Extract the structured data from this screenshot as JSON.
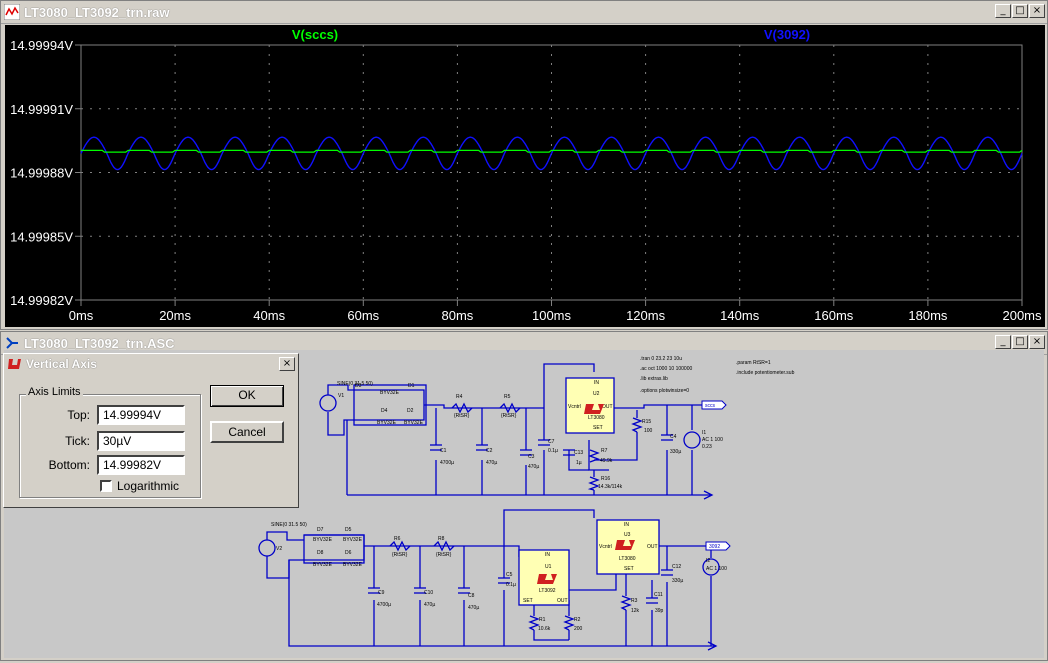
{
  "waveform_window": {
    "title": "LT3080_LT3092_trn.raw",
    "controls": {
      "minimize": "_",
      "maximize": "□",
      "close": "×"
    }
  },
  "chart_data": {
    "type": "line",
    "series": [
      {
        "name": "V(sccs)",
        "color": "#00ff00"
      },
      {
        "name": "V(3092)",
        "color": "#1010ff"
      }
    ],
    "x_ticks": [
      "0ms",
      "20ms",
      "40ms",
      "60ms",
      "80ms",
      "100ms",
      "120ms",
      "140ms",
      "160ms",
      "180ms",
      "200ms"
    ],
    "y_ticks": [
      "14.99994V",
      "14.99991V",
      "14.99988V",
      "14.99985V",
      "14.99982V"
    ],
    "xlim": [
      0,
      200
    ],
    "ylim": [
      14.99982,
      14.99994
    ],
    "sccs_level": 14.99989,
    "v3092_mean": 14.999889,
    "v3092_amplitude": 8e-06,
    "v3092_period_ms": 10
  },
  "schematic_window": {
    "title": "LT3080_LT3092_trn.ASC",
    "controls": {
      "minimize": "_",
      "maximize": "□",
      "close": "×"
    },
    "directives": [
      ".tran 0 23.2 23 10u",
      ".ac oct 1000 10 100000",
      ".lib extras.lib",
      ".options plotwinsize=0",
      ".param RtSR=1",
      ".include potentiometer.sub"
    ],
    "labels": {
      "v1": "V1",
      "v1src": "SINE(0 31.5 50)",
      "v2": "V2",
      "v2src": "SINE(0 31.5 50)",
      "d3": "D3",
      "d1": "D1",
      "d4": "D4",
      "d2": "D2",
      "d7": "D7",
      "d5": "D5",
      "d8": "D8",
      "d6": "D6",
      "diode": "BYV32E",
      "r4": "R4",
      "r5": "R5",
      "r6": "R6",
      "r8": "R8",
      "rval": "{RtSR}",
      "c1": "C1",
      "c2": "C2",
      "c3": "C3",
      "c7": "C7",
      "c13": "C13",
      "c4": "C4",
      "c9": "C9",
      "c10": "C10",
      "c8": "C8",
      "c5": "C5",
      "c11": "C11",
      "c12": "C12",
      "v4700": "4700µ",
      "v470": "470µ",
      "v01": "0.1µ",
      "v1u": "1µ",
      "v330": "330µ",
      "v39": "39p",
      "u2": "U2",
      "lt3080": "LT3080",
      "u3": "U3",
      "u1": "U1",
      "lt3092": "LT3092",
      "in": "IN",
      "out": "OUT",
      "set": "SET",
      "vcontrol": "Vcntrl",
      "r15": "R15",
      "r15v": "100",
      "r7": "R7",
      "r7v": "49.9k",
      "r16": "R16",
      "r16v": "14.3k/114k",
      "r3": "R3",
      "r3v": "12k",
      "r1": "R1",
      "r1v": "10.6k",
      "r2": "R2",
      "r2v": "200",
      "i1": "I1",
      "i1v": "AC 1 100",
      "i1v2": "0.23",
      "i2": "I2",
      "i2v": "AC 1 100",
      "i2v2": "0.25",
      "sccs": "sccs",
      "n3092": "3092"
    }
  },
  "dialog": {
    "title": "Vertical Axis",
    "group_label": "Axis Limits",
    "top_label": "Top:",
    "top_value": "14.99994V",
    "tick_label": "Tick:",
    "tick_value": "30µV",
    "bottom_label": "Bottom:",
    "bottom_value": "14.99982V",
    "log_label": "Logarithmic",
    "ok_label": "OK",
    "cancel_label": "Cancel",
    "close": "×"
  }
}
